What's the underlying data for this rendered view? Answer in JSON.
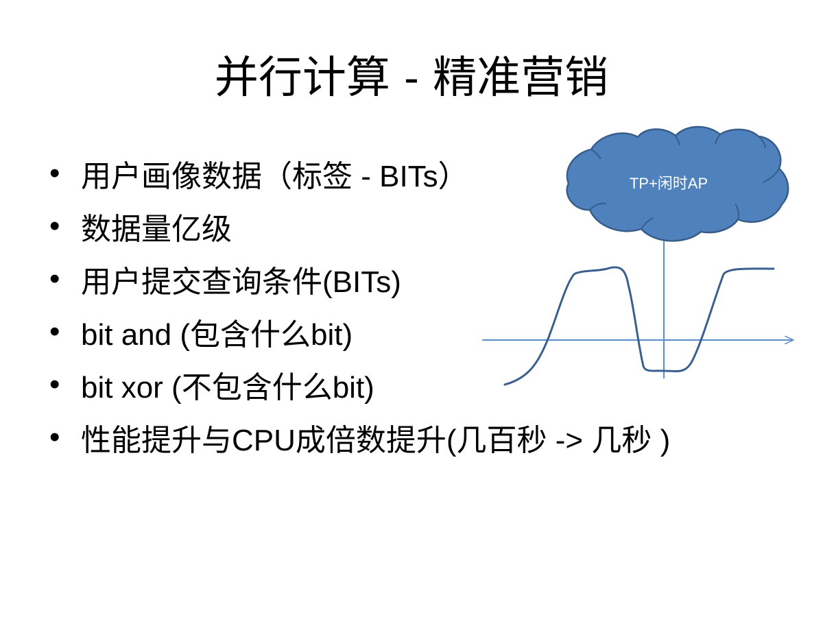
{
  "slide": {
    "title": "并行计算 - 精准营销",
    "bullet_glyph": "•",
    "bullets": [
      "用户画像数据（标签 -  BITs）",
      "数据量亿级",
      "用户提交查询条件(BITs)",
      "bit and (包含什么bit)",
      "bit xor (不包含什么bit)",
      "性能提升与CPU成倍数提升(几百秒 -> 几秒 )"
    ]
  },
  "diagram": {
    "cloud_label": "TP+闲时AP",
    "colors": {
      "cloud_fill": "#4f81bd",
      "cloud_stroke": "#385d8a",
      "curve": "#3a5f8e",
      "axis": "#5b8cc9",
      "cloud_text": "#ffffff"
    }
  }
}
